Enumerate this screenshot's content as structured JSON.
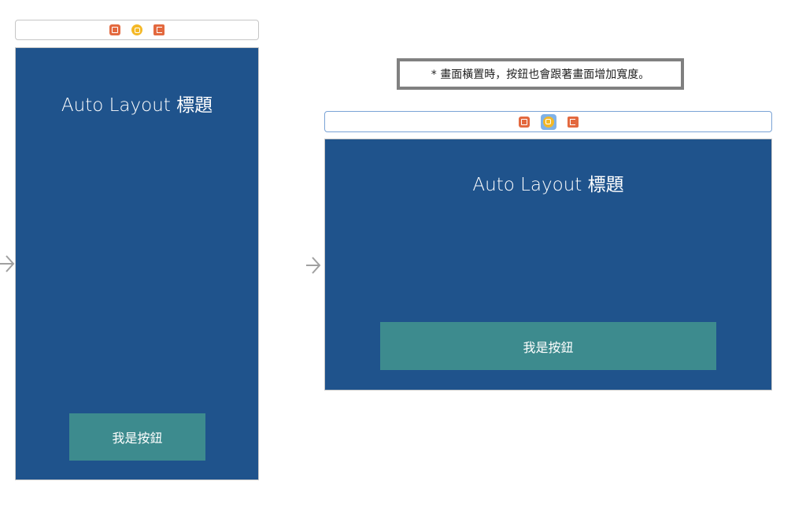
{
  "note": {
    "text": "* 畫面橫置時，按鈕也會跟著畫面增加寬度。"
  },
  "scenes": {
    "portrait": {
      "scene_bar_icons": [
        "view-controller-cube-icon",
        "first-responder-icon",
        "exit-icon"
      ],
      "title": "Auto Layout 標題",
      "button_label": "我是按鈕"
    },
    "landscape": {
      "scene_bar_icons": [
        "view-controller-cube-icon",
        "first-responder-icon",
        "exit-icon"
      ],
      "title": "Auto Layout 標題",
      "button_label": "我是按鈕"
    }
  },
  "colors": {
    "view_background": "#1f538c",
    "button_background": "#3d8b8e",
    "icon_orange": "#e3693f",
    "icon_yellow": "#f4b826",
    "selected_icon_background": "#7fb2e8"
  }
}
